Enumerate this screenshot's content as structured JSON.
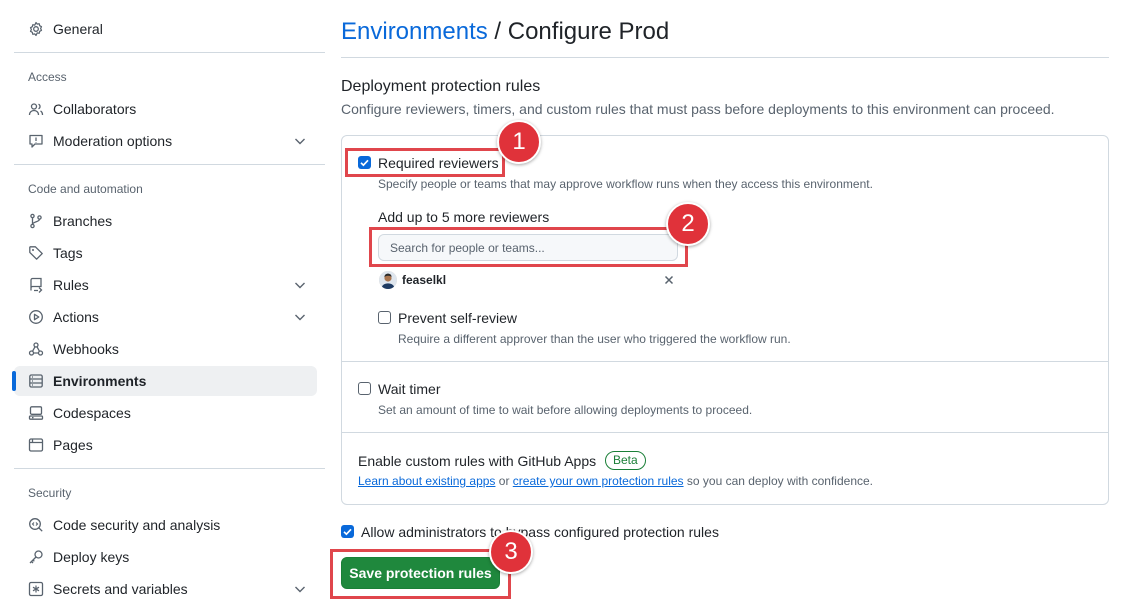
{
  "sidebar": {
    "general": "General",
    "access_heading": "Access",
    "collaborators": "Collaborators",
    "moderation": "Moderation options",
    "code_heading": "Code and automation",
    "branches": "Branches",
    "tags": "Tags",
    "rules": "Rules",
    "actions": "Actions",
    "webhooks": "Webhooks",
    "environments": "Environments",
    "codespaces": "Codespaces",
    "pages": "Pages",
    "security_heading": "Security",
    "code_security": "Code security and analysis",
    "deploy_keys": "Deploy keys",
    "secrets": "Secrets and variables"
  },
  "header": {
    "breadcrumb_link": "Environments",
    "breadcrumb_sep": "/",
    "page": "Configure Prod"
  },
  "section": {
    "title": "Deployment protection rules",
    "description": "Configure reviewers, timers, and custom rules that must pass before deployments to this environment can proceed."
  },
  "required_reviewers": {
    "label": "Required reviewers",
    "checked": true,
    "note": "Specify people or teams that may approve workflow runs when they access this environment.",
    "add_label": "Add up to 5 more reviewers",
    "search_placeholder": "Search for people or teams...",
    "reviewer": "feaselkl",
    "prevent_self_review": "Prevent self-review",
    "prevent_self_review_checked": false,
    "prevent_note": "Require a different approver than the user who triggered the workflow run."
  },
  "wait_timer": {
    "label": "Wait timer",
    "checked": false,
    "note": "Set an amount of time to wait before allowing deployments to proceed."
  },
  "custom_rules": {
    "label": "Enable custom rules with GitHub Apps",
    "badge": "Beta",
    "link1": "Learn about existing apps",
    "or": " or ",
    "link2": "create your own protection rules",
    "rest": " so you can deploy with confidence."
  },
  "admin_bypass": {
    "label": "Allow administrators to bypass configured protection rules",
    "checked": true
  },
  "save_button": "Save protection rules",
  "annotations": [
    "1",
    "2",
    "3"
  ],
  "colors": {
    "accent": "#0969da",
    "primary_button": "#1f883d",
    "annotation": "#e0323a"
  }
}
